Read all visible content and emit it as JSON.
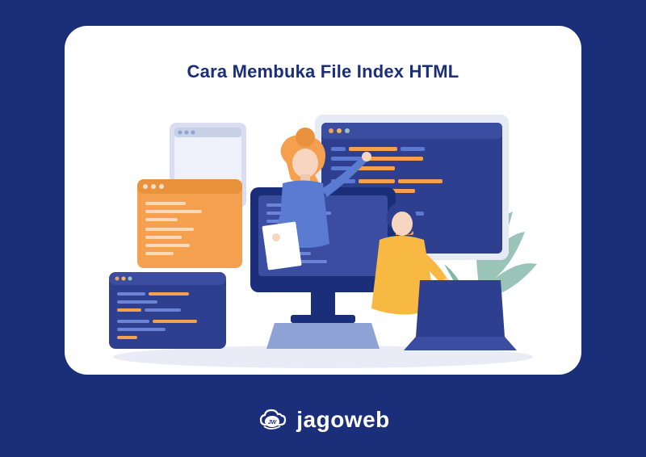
{
  "card": {
    "title": "Cara Membuka File Index HTML"
  },
  "brand": {
    "name": "jagoweb",
    "icon_name": "cloud-badge-icon"
  },
  "colors": {
    "background": "#1a2e7a",
    "card_bg": "#ffffff",
    "title_color": "#1a2e7a",
    "accent_orange": "#f5a04e",
    "accent_blue": "#5b7bd3",
    "accent_navy": "#2e3f8f",
    "accent_yellow": "#f8b942",
    "accent_teal": "#7fb8a8"
  }
}
